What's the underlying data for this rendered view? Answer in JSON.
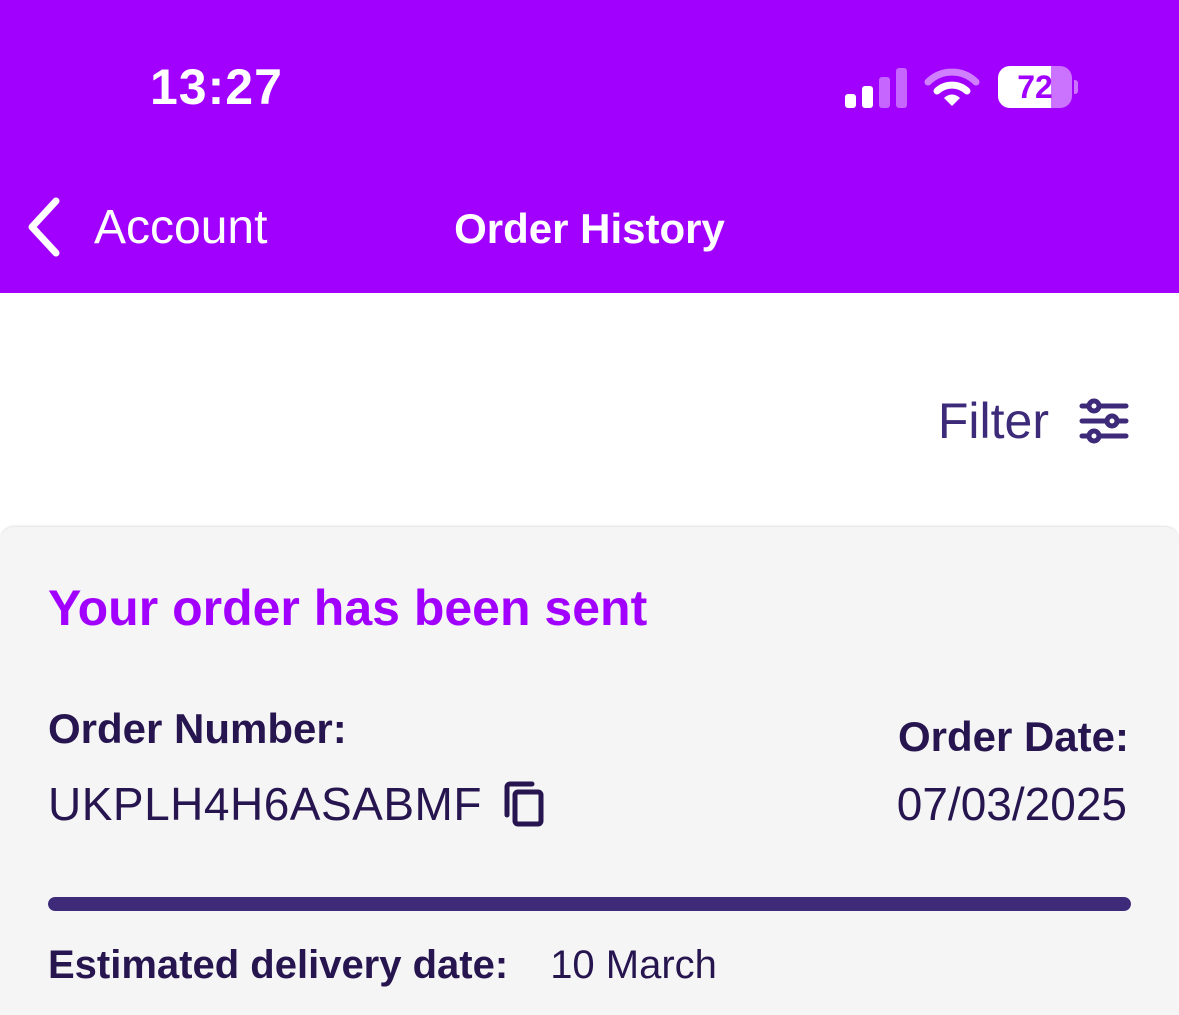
{
  "status_bar": {
    "time": "13:27",
    "battery_percent": "72",
    "battery_level": 0.72,
    "signal_bars_active": 2,
    "signal_bars_total": 4
  },
  "nav": {
    "back_label": "Account",
    "title": "Order History"
  },
  "filter": {
    "label": "Filter"
  },
  "order": {
    "status": "Your order has been sent",
    "number_label": "Order Number:",
    "number_value": "UKPLH4H6ASABMF",
    "date_label": "Order Date:",
    "date_value": "07/03/2025",
    "progress": 1.0,
    "delivery_label": "Estimated delivery date:",
    "delivery_value": "10 March"
  },
  "colors": {
    "brand": "#a100ff",
    "text_dark": "#26154f",
    "progress": "#3d2a78",
    "card_bg": "#f5f5f5"
  },
  "icons": {
    "back": "chevron-left-icon",
    "filter": "sliders-icon",
    "copy": "copy-icon",
    "signal": "cellular-signal-icon",
    "wifi": "wifi-icon",
    "battery": "battery-icon"
  }
}
